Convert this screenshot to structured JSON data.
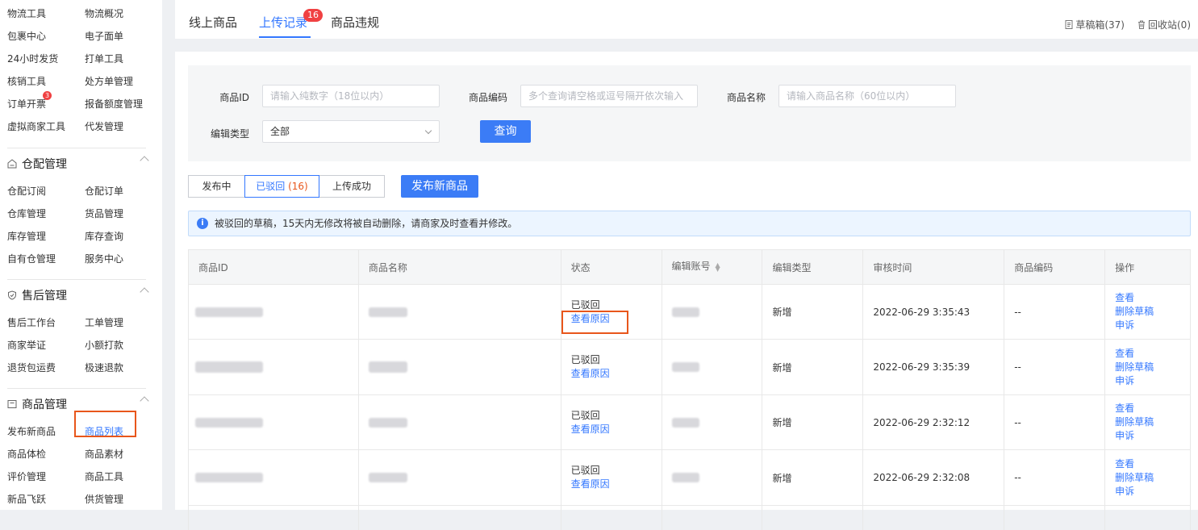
{
  "sidebar": {
    "top_items": [
      "物流工具",
      "物流概况",
      "包裹中心",
      "电子面单",
      "24小时发货",
      "打单工具",
      "核销工具",
      "处方单管理",
      "订单开票",
      "报备额度管理",
      "虚拟商家工具",
      "代发管理"
    ],
    "verify_badge": "3",
    "sections": [
      {
        "title": "仓配管理",
        "icon": "warehouse-icon",
        "items": [
          "仓配订阅",
          "仓配订单",
          "仓库管理",
          "货品管理",
          "库存管理",
          "库存查询",
          "自有仓管理",
          "服务中心"
        ]
      },
      {
        "title": "售后管理",
        "icon": "shield-check-icon",
        "items": [
          "售后工作台",
          "工单管理",
          "商家举证",
          "小额打款",
          "退货包运费",
          "极速退款"
        ]
      },
      {
        "title": "商品管理",
        "icon": "product-box-icon",
        "items": [
          "发布新商品",
          "商品列表",
          "商品体检",
          "商品素材",
          "评价管理",
          "商品工具",
          "新品飞跃",
          "供货管理"
        ]
      }
    ]
  },
  "tabs": {
    "items": [
      "线上商品",
      "上传记录",
      "商品违规"
    ],
    "active": "上传记录",
    "badge": "16",
    "drafts": "草稿箱(37)",
    "recycle": "回收站(0)"
  },
  "filters": {
    "product_id": {
      "label": "商品ID",
      "placeholder": "请输入纯数字（18位以内）"
    },
    "product_code": {
      "label": "商品编码",
      "placeholder": "多个查询请空格或逗号隔开依次输入"
    },
    "product_name": {
      "label": "商品名称",
      "placeholder": "请输入商品名称（60位以内）"
    },
    "edit_type": {
      "label": "编辑类型",
      "value": "全部"
    },
    "query_button": "查询"
  },
  "status_tabs": [
    {
      "label": "发布中",
      "count": ""
    },
    {
      "label": "已驳回",
      "count": "(16)"
    },
    {
      "label": "上传成功",
      "count": ""
    }
  ],
  "publish_button": "发布新商品",
  "notice": "被驳回的草稿，15天内无修改将被自动删除，请商家及时查看并修改。",
  "table": {
    "headers": [
      "商品ID",
      "商品名称",
      "状态",
      "编辑账号",
      "编辑类型",
      "审核时间",
      "商品编码",
      "操作"
    ],
    "rows": [
      {
        "status": "已驳回",
        "reason": "查看原因",
        "edit_type": "新增",
        "time": "2022-06-29 3:35:43",
        "code": "--"
      },
      {
        "status": "已驳回",
        "reason": "查看原因",
        "edit_type": "新增",
        "time": "2022-06-29 3:35:39",
        "code": "--"
      },
      {
        "status": "已驳回",
        "reason": "查看原因",
        "edit_type": "新增",
        "time": "2022-06-29 2:32:12",
        "code": "--"
      },
      {
        "status": "已驳回",
        "reason": "查看原因",
        "edit_type": "新增",
        "time": "2022-06-29 2:32:08",
        "code": "--"
      }
    ],
    "actions": [
      "查看",
      "删除草稿",
      "申诉"
    ]
  },
  "colors": {
    "accent": "#3377ff",
    "badge": "#f04142",
    "highlight": "#e8561b",
    "primary_button": "#3b7cf6"
  }
}
